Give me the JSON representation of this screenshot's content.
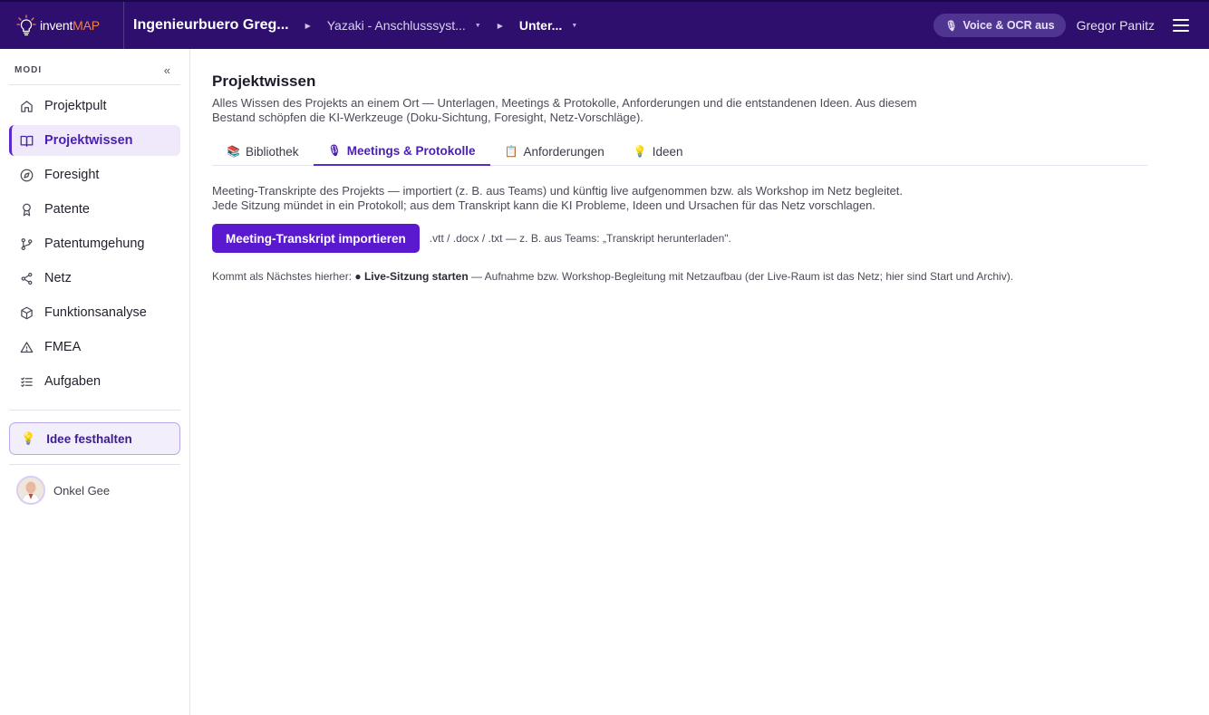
{
  "brand": {
    "name_part1": "invent",
    "name_part2": "MAP"
  },
  "breadcrumb": {
    "org": "Ingenieurbuero Greg...",
    "project": "Yazaki - Anschlusssyst...",
    "sub": "Unter..."
  },
  "topbar": {
    "voice_label": "Voice & OCR aus",
    "user_name": "Gregor Panitz"
  },
  "sidebar": {
    "section_label": "MODI",
    "collapse_label": "«",
    "items": [
      {
        "label": "Projektpult",
        "icon": "home-icon"
      },
      {
        "label": "Projektwissen",
        "icon": "book-icon"
      },
      {
        "label": "Foresight",
        "icon": "compass-icon"
      },
      {
        "label": "Patente",
        "icon": "award-icon"
      },
      {
        "label": "Patentumgehung",
        "icon": "git-branch-icon"
      },
      {
        "label": "Netz",
        "icon": "share-icon"
      },
      {
        "label": "Funktionsanalyse",
        "icon": "cube-icon"
      },
      {
        "label": "FMEA",
        "icon": "warning-icon"
      },
      {
        "label": "Aufgaben",
        "icon": "list-icon"
      }
    ],
    "idea_button": "Idee festhalten",
    "user": "Onkel Gee"
  },
  "main": {
    "title": "Projektwissen",
    "description": "Alles Wissen des Projekts an einem Ort — Unterlagen, Meetings & Protokolle, Anforderungen und die entstandenen Ideen. Aus diesem Bestand schöpfen die KI-Werkzeuge (Doku-Sichtung, Foresight, Netz-Vorschläge).",
    "tabs": [
      {
        "label": "Bibliothek",
        "icon": "📚"
      },
      {
        "label": "Meetings & Protokolle",
        "icon": "🎙"
      },
      {
        "label": "Anforderungen",
        "icon": "📋"
      },
      {
        "label": "Ideen",
        "icon": "💡"
      }
    ],
    "active_tab": "Meetings & Protokolle",
    "content_description": "Meeting-Transkripte des Projekts — importiert (z. B. aus Teams) und künftig live aufgenommen bzw. als Workshop im Netz begleitet. Jede Sitzung mündet in ein Protokoll; aus dem Transkript kann die KI Probleme, Ideen und Ursachen für das Netz vorschlagen.",
    "import_button": "Meeting-Transkript importieren",
    "import_hint": ".vtt / .docx / .txt — z. B. aus Teams: „Transkript herunterladen\".",
    "next_prefix": "Kommt als Nächstes hierher: ",
    "next_bold": "● Live-Sitzung starten",
    "next_suffix": " — Aufnahme bzw. Workshop-Begleitung mit Netzaufbau (der Live-Raum ist das Netz; hier sind Start und Archiv)."
  },
  "colors": {
    "topbar_bg": "#2e0f6e",
    "accent": "#5a18cf",
    "brand_orange": "#f0804a",
    "active_bg": "#efe9fb"
  }
}
